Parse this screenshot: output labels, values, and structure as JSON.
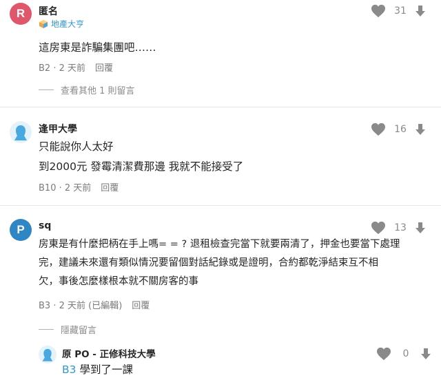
{
  "colors": {
    "avatar_r": "#e0566b",
    "avatar_p": "#2f86c5",
    "avatar_default_bg": "#e3f2fb",
    "avatar_default_fg": "#4aa8e0",
    "link_blue": "#3397cf",
    "icon_grey": "#8a8a8a"
  },
  "comments": [
    {
      "avatar_letter": "R",
      "username": "匿名",
      "badge_icon": "cube-icon",
      "badge_label": "地產大亨",
      "lines": [
        "這房東是詐騙集團吧……"
      ],
      "floor": "B2",
      "time": "2 天前",
      "reply_label": "回覆",
      "likes": "31",
      "more_replies": "查看其他 1 則留言"
    },
    {
      "avatar_icon": "default-user-icon",
      "username": "逢甲大學",
      "lines": [
        "只能說你人太好",
        "到2000元 發霉清潔費那邊 我就不能接受了"
      ],
      "floor": "B10",
      "time": "2 天前",
      "reply_label": "回覆",
      "likes": "16"
    },
    {
      "avatar_letter": "P",
      "username": "sq",
      "lines": [
        "房東是有什麼把柄在手上嗎= = ? 退租檢查完當下就要兩清了，押金也要當下處理",
        "完，建議未來還有類似情況要留個對話紀錄或是證明，合約都乾淨結束互不相",
        "欠，事後怎麼樣根本就不關房客的事"
      ],
      "floor": "B3",
      "time": "2 天前 (已編輯)",
      "reply_label": "回覆",
      "likes": "13",
      "hide_replies": "隱藏留言"
    }
  ],
  "reply": {
    "username": "原 PO - 正修科技大學",
    "quote_ref": "B3",
    "text": "學到了一課",
    "likes": "0"
  }
}
